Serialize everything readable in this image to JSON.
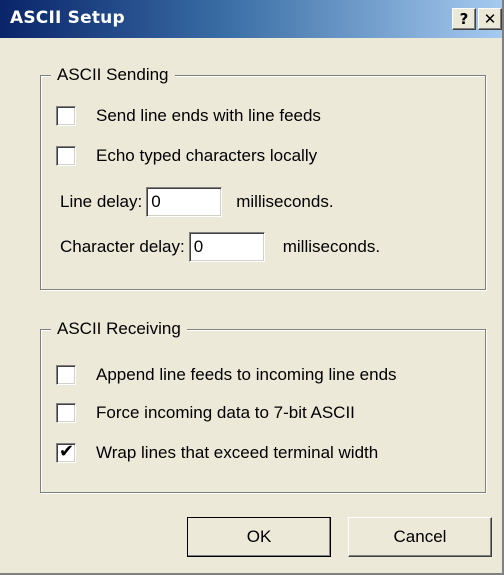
{
  "window": {
    "title": "ASCII Setup",
    "help_label": "?",
    "close_label": "✕"
  },
  "sending": {
    "legend": "ASCII Sending",
    "send_line_ends": {
      "label": "Send line ends with line feeds",
      "checked": false
    },
    "echo_typed": {
      "label": "Echo typed characters locally",
      "checked": false
    },
    "line_delay": {
      "label": "Line delay:",
      "value": "0",
      "unit": "milliseconds."
    },
    "char_delay": {
      "label": "Character delay:",
      "value": "0",
      "unit": "milliseconds."
    }
  },
  "receiving": {
    "legend": "ASCII Receiving",
    "append_line_feeds": {
      "label": "Append line feeds to incoming line ends",
      "checked": false
    },
    "force_7bit": {
      "label": "Force incoming data to 7-bit ASCII",
      "checked": false
    },
    "wrap_lines": {
      "label": "Wrap lines that exceed terminal width",
      "checked": true,
      "mark": "✔"
    }
  },
  "buttons": {
    "ok": "OK",
    "cancel": "Cancel"
  }
}
